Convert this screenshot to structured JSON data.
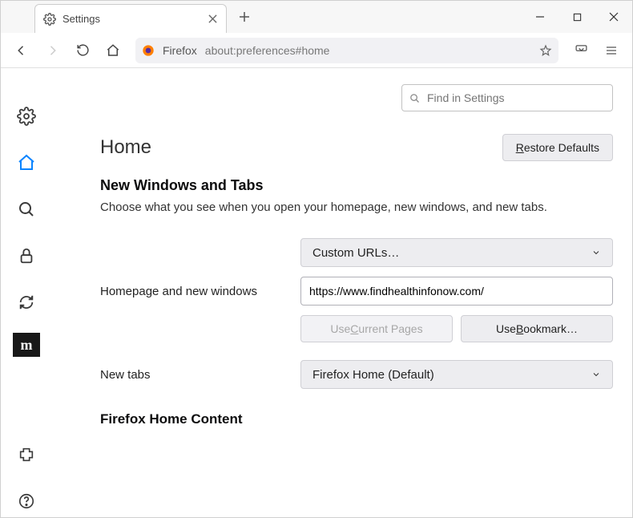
{
  "tab": {
    "title": "Settings"
  },
  "toolbar": {
    "addr_label": "Firefox",
    "addr_url": "about:preferences#home"
  },
  "search": {
    "placeholder": "Find in Settings"
  },
  "page": {
    "heading": "Home",
    "restore_defaults": "Restore Defaults",
    "section1_title": "New Windows and Tabs",
    "section1_desc": "Choose what you see when you open your homepage, new windows, and new tabs.",
    "homepage_label": "Homepage and new windows",
    "homepage_select": "Custom URLs…",
    "homepage_url": "https://www.findhealthinfonow.com/",
    "use_current": "Use Current Pages",
    "use_bookmark": "Use Bookmark…",
    "newtabs_label": "New tabs",
    "newtabs_select": "Firefox Home (Default)",
    "section2_title": "Firefox Home Content"
  },
  "sidebar_m": "m"
}
